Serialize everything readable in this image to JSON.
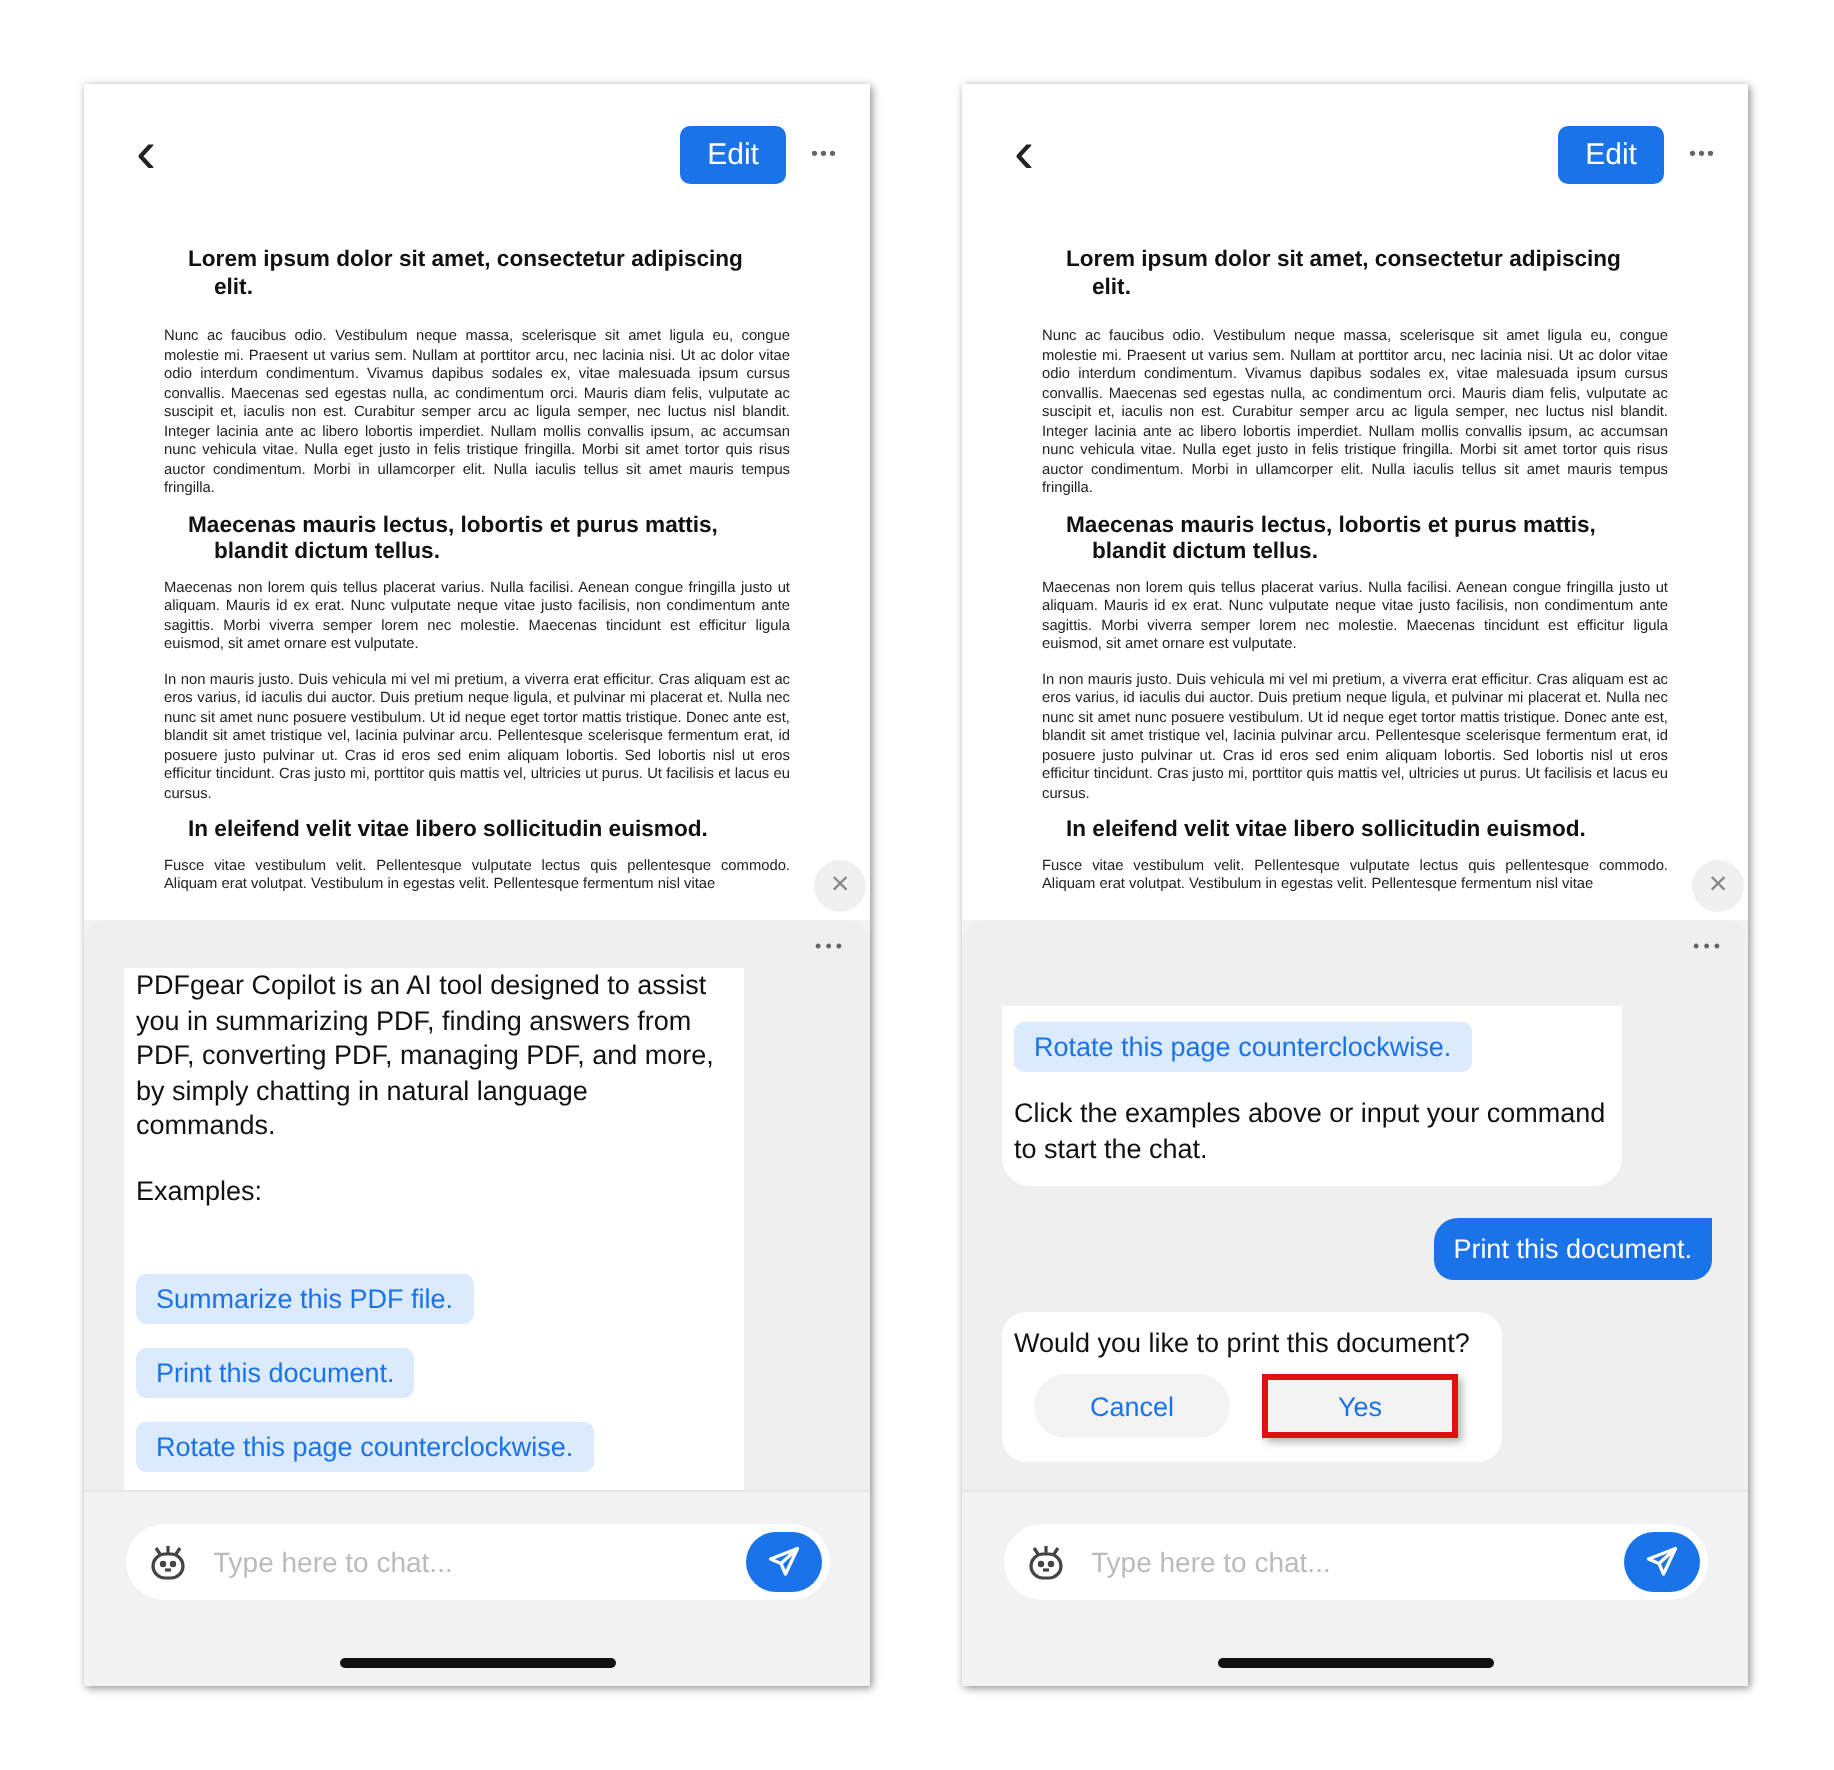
{
  "screens": [
    {
      "header": {
        "back": "‹",
        "edit": "Edit",
        "more": "•••"
      },
      "document": [
        {
          "kind": "heading",
          "text": "Lorem ipsum dolor sit amet, consectetur adipiscing elit."
        },
        {
          "kind": "paragraph",
          "text": "Nunc ac faucibus odio. Vestibulum neque massa, scelerisque sit amet ligula eu, congue molestie mi. Praesent ut varius sem. Nullam at porttitor arcu, nec lacinia nisi. Ut ac dolor vitae odio interdum condimentum. Vivamus dapibus sodales ex, vitae malesuada ipsum cursus convallis. Maecenas sed egestas nulla, ac condimentum orci. Mauris diam felis, vulputate ac suscipit et, iaculis non est. Curabitur semper arcu ac ligula semper, nec luctus nisl blandit. Integer lacinia ante ac libero lobortis imperdiet. Nullam mollis convallis ipsum, ac accumsan nunc vehicula vitae. Nulla eget justo in felis tristique fringilla. Morbi sit amet tortor quis risus auctor condimentum. Morbi in ullamcorper elit. Nulla iaculis tellus sit amet mauris tempus fringilla."
        },
        {
          "kind": "heading",
          "text": "Maecenas mauris lectus, lobortis et purus mattis, blandit dictum tellus."
        },
        {
          "kind": "paragraph",
          "text": "Maecenas non lorem quis tellus placerat varius. Nulla facilisi. Aenean congue fringilla justo ut aliquam. Mauris id ex erat. Nunc vulputate neque vitae justo facilisis, non condimentum ante sagittis. Morbi viverra semper lorem nec molestie. Maecenas tincidunt est efficitur ligula euismod, sit amet ornare est vulputate."
        },
        {
          "kind": "paragraph",
          "text": "In non mauris justo. Duis vehicula mi vel mi pretium, a viverra erat efficitur. Cras aliquam est ac eros varius, id iaculis dui auctor. Duis pretium neque ligula, et pulvinar mi placerat et. Nulla nec nunc sit amet nunc posuere vestibulum. Ut id neque eget tortor mattis tristique. Donec ante est, blandit sit amet tristique vel, lacinia pulvinar arcu. Pellentesque scelerisque fermentum erat, id posuere justo pulvinar ut. Cras id eros sed enim aliquam lobortis. Sed lobortis nisl ut eros efficitur tincidunt. Cras justo mi, porttitor quis mattis vel, ultricies ut purus. Ut facilisis et lacus eu cursus."
        },
        {
          "kind": "heading",
          "text": "In eleifend velit vitae libero sollicitudin euismod."
        },
        {
          "kind": "paragraph",
          "text": "Fusce vitae vestibulum velit. Pellentesque vulputate lectus quis pellentesque commodo. Aliquam erat volutpat. Vestibulum in egestas velit. Pellentesque fermentum nisl vitae"
        }
      ],
      "close": "×",
      "panel_more": "•••",
      "messages": [
        {
          "kind": "bot",
          "text": "PDFgear Copilot is an AI tool designed to assist you in summarizing PDF, finding answers from PDF, converting PDF, managing PDF, and more, by simply chatting in natural language commands.",
          "label": "Examples:",
          "examples": [
            "Summarize this PDF file.",
            "Print this document.",
            "Rotate this page counterclockwise."
          ]
        }
      ],
      "input": {
        "placeholder": "Type here to chat..."
      }
    },
    {
      "header": {
        "back": "‹",
        "edit": "Edit",
        "more": "•••"
      },
      "document": [
        {
          "kind": "heading",
          "text": "Lorem ipsum dolor sit amet, consectetur adipiscing elit."
        },
        {
          "kind": "paragraph",
          "text": "Nunc ac faucibus odio. Vestibulum neque massa, scelerisque sit amet ligula eu, congue molestie mi. Praesent ut varius sem. Nullam at porttitor arcu, nec lacinia nisi. Ut ac dolor vitae odio interdum condimentum. Vivamus dapibus sodales ex, vitae malesuada ipsum cursus convallis. Maecenas sed egestas nulla, ac condimentum orci. Mauris diam felis, vulputate ac suscipit et, iaculis non est. Curabitur semper arcu ac ligula semper, nec luctus nisl blandit. Integer lacinia ante ac libero lobortis imperdiet. Nullam mollis convallis ipsum, ac accumsan nunc vehicula vitae. Nulla eget justo in felis tristique fringilla. Morbi sit amet tortor quis risus auctor condimentum. Morbi in ullamcorper elit. Nulla iaculis tellus sit amet mauris tempus fringilla."
        },
        {
          "kind": "heading",
          "text": "Maecenas mauris lectus, lobortis et purus mattis, blandit dictum tellus."
        },
        {
          "kind": "paragraph",
          "text": "Maecenas non lorem quis tellus placerat varius. Nulla facilisi. Aenean congue fringilla justo ut aliquam. Mauris id ex erat. Nunc vulputate neque vitae justo facilisis, non condimentum ante sagittis. Morbi viverra semper lorem nec molestie. Maecenas tincidunt est efficitur ligula euismod, sit amet ornare est vulputate."
        },
        {
          "kind": "paragraph",
          "text": "In non mauris justo. Duis vehicula mi vel mi pretium, a viverra erat efficitur. Cras aliquam est ac eros varius, id iaculis dui auctor. Duis pretium neque ligula, et pulvinar mi placerat et. Nulla nec nunc sit amet nunc posuere vestibulum. Ut id neque eget tortor mattis tristique. Donec ante est, blandit sit amet tristique vel, lacinia pulvinar arcu. Pellentesque scelerisque fermentum erat, id posuere justo pulvinar ut. Cras id eros sed enim aliquam lobortis. Sed lobortis nisl ut eros efficitur tincidunt. Cras justo mi, porttitor quis mattis vel, ultricies ut purus. Ut facilisis et lacus eu cursus."
        },
        {
          "kind": "heading",
          "text": "In eleifend velit vitae libero sollicitudin euismod."
        },
        {
          "kind": "paragraph",
          "text": "Fusce vitae vestibulum velit. Pellentesque vulputate lectus quis pellentesque commodo. Aliquam erat volutpat. Vestibulum in egestas velit. Pellentesque fermentum nisl vitae"
        }
      ],
      "close": "×",
      "panel_more": "•••",
      "messages": [
        {
          "kind": "bot",
          "examples": [
            "Rotate this page counterclockwise."
          ],
          "closing": "Click the examples above or input your command to start the chat."
        },
        {
          "kind": "user",
          "text": "Print this document."
        },
        {
          "kind": "confirm",
          "text": "Would you like to print this document?",
          "buttons": [
            {
              "label": "Cancel",
              "highlighted": false
            },
            {
              "label": "Yes",
              "highlighted": true
            }
          ]
        }
      ],
      "input": {
        "placeholder": "Type here to chat..."
      }
    }
  ]
}
